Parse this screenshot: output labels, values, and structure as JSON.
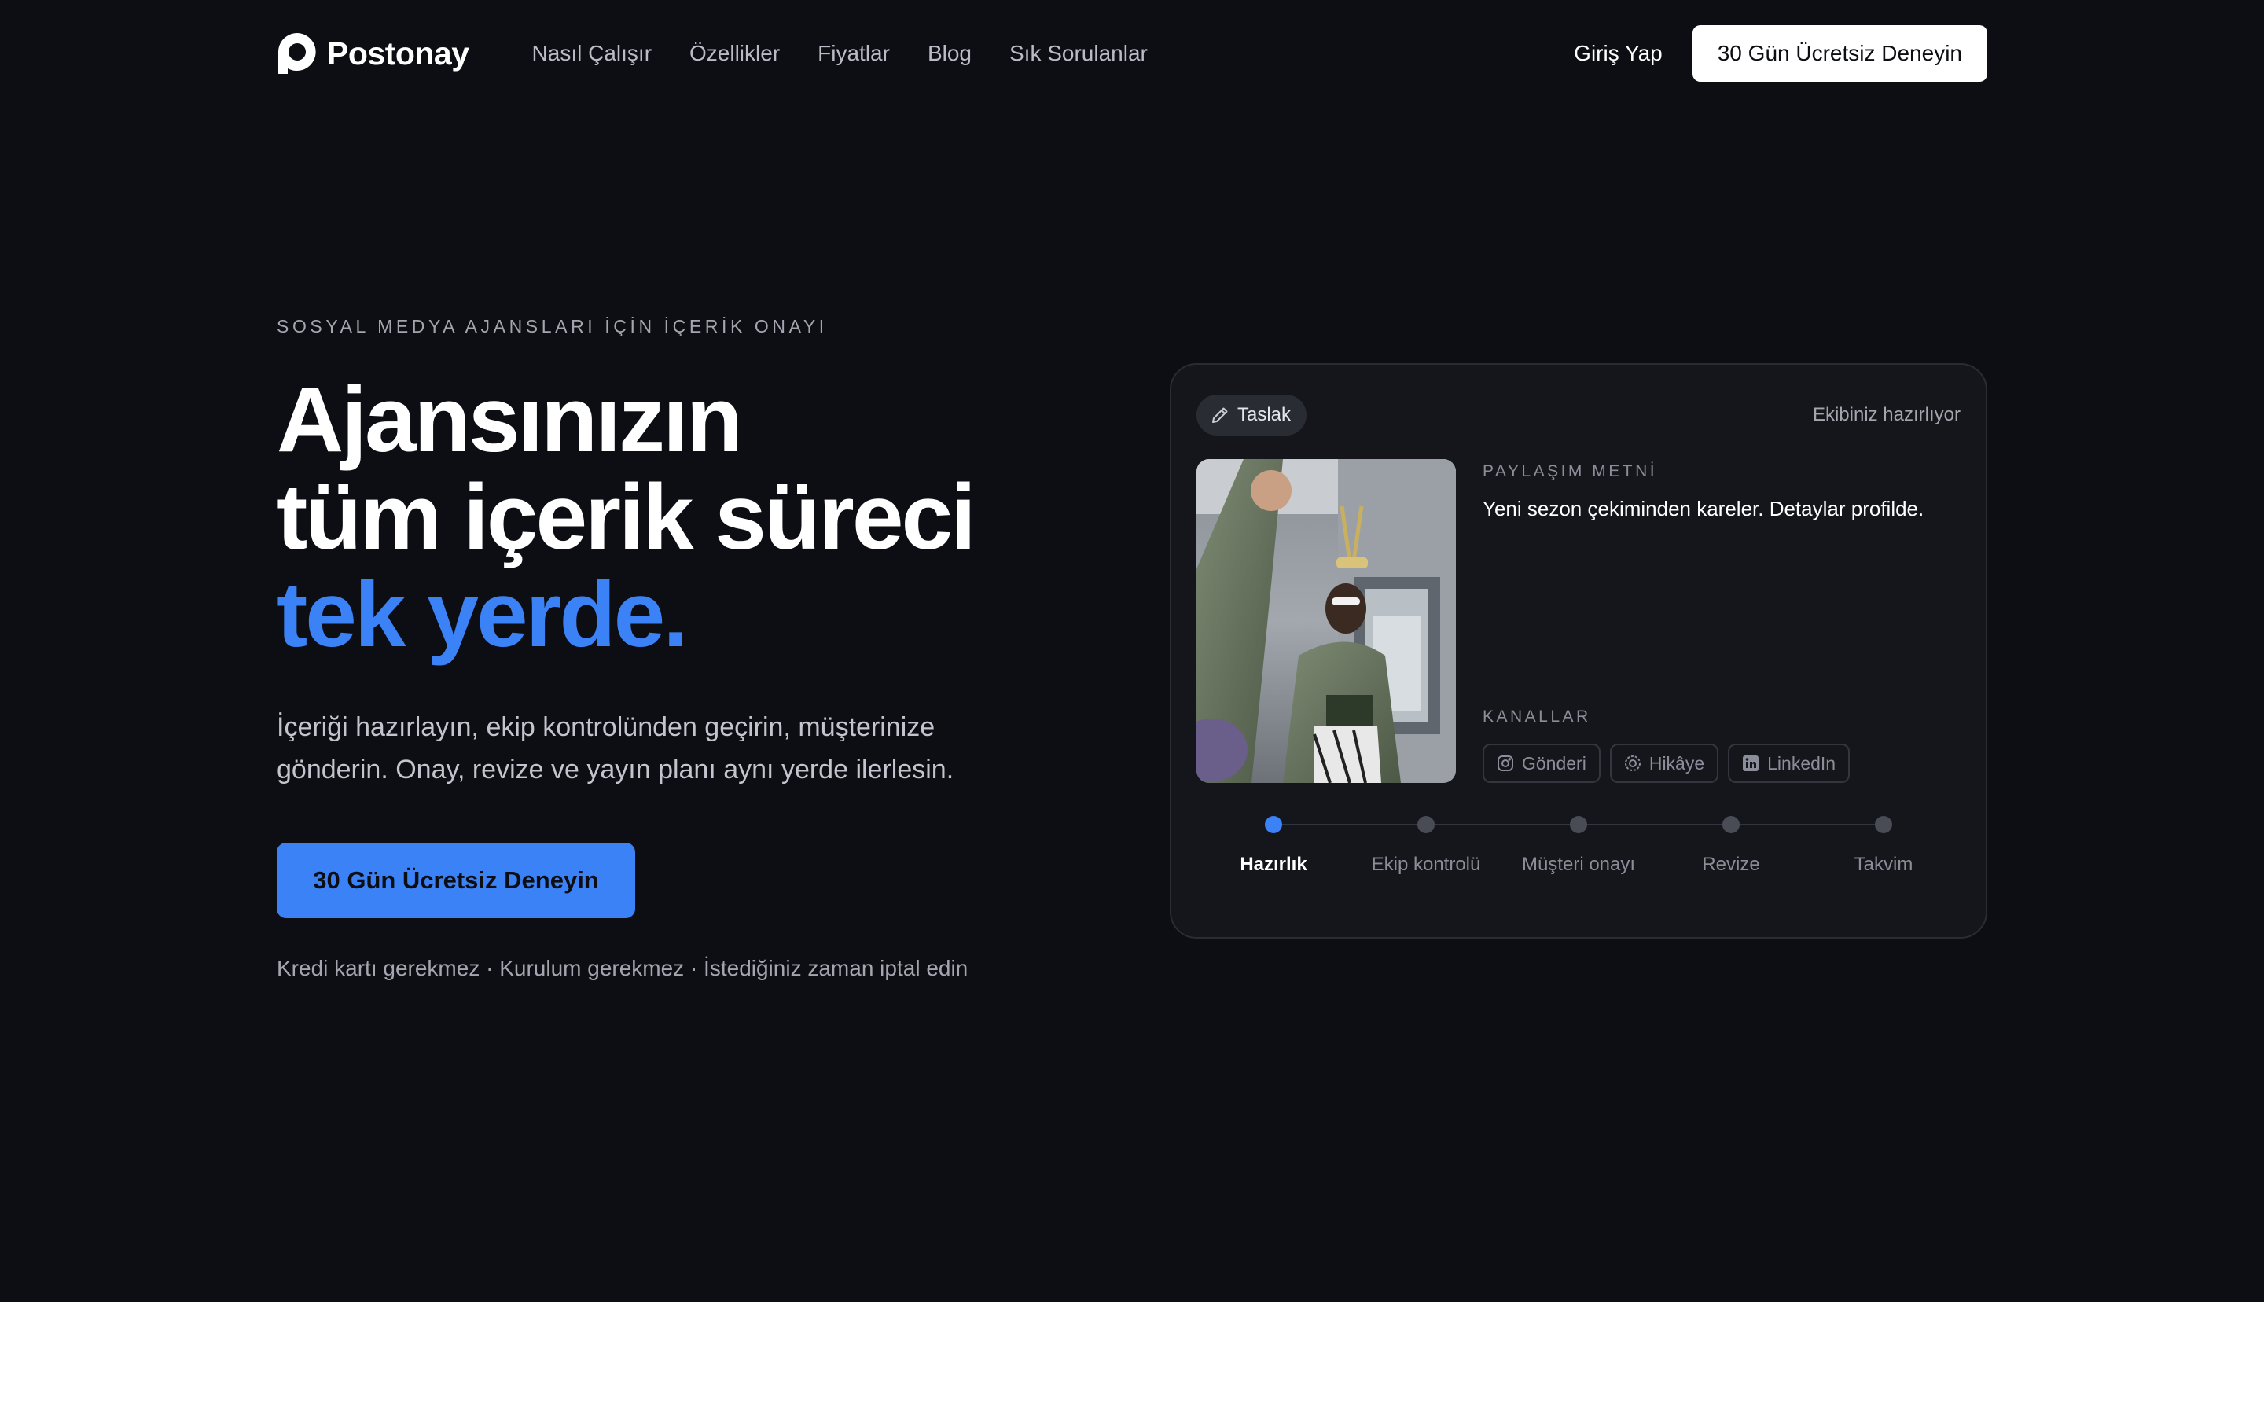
{
  "brand": {
    "name": "Postonay",
    "accent": "#3b82f6",
    "background": "#0d0e13"
  },
  "nav": {
    "links": [
      "Nasıl Çalışır",
      "Özellikler",
      "Fiyatlar",
      "Blog",
      "Sık Sorulanlar"
    ],
    "login": "Giriş Yap",
    "cta": "30 Gün Ücretsiz Deneyin"
  },
  "hero": {
    "eyebrow": "SOSYAL MEDYA AJANSLARI İÇİN İÇERİK ONAYI",
    "headline_line1": "Ajansınızın",
    "headline_line2": "tüm içerik süreci",
    "headline_accent": "tek yerde.",
    "subtitle_line1": "İçeriği hazırlayın, ekip kontrolünden geçirin, müşterinize",
    "subtitle_line2": "gönderin. Onay, revize ve yayın planı aynı yerde ilerlesin.",
    "cta": "30 Gün Ücretsiz Deneyin",
    "footnote": "Kredi kartı gerekmez · Kurulum gerekmez · İstediğiniz zaman iptal edin"
  },
  "card": {
    "badge": "Taslak",
    "badge_icon": "pencil-icon",
    "status": "Ekibiniz hazırlıyor",
    "caption_label": "PAYLAŞIM METNİ",
    "caption": "Yeni sezon çekiminden kareler. Detaylar profilde.",
    "channels_label": "KANALLAR",
    "channels": [
      {
        "label": "Gönderi",
        "icon": "instagram-icon"
      },
      {
        "label": "Hikâye",
        "icon": "story-icon"
      },
      {
        "label": "LinkedIn",
        "icon": "linkedin-icon"
      }
    ],
    "steps": [
      "Hazırlık",
      "Ekip kontrolü",
      "Müşteri onayı",
      "Revize",
      "Takvim"
    ],
    "active_step": 0
  }
}
